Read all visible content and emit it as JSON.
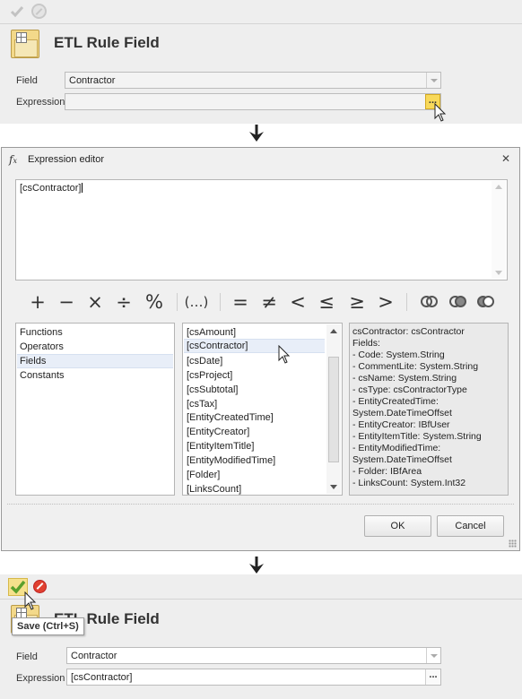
{
  "top_form": {
    "toolbar": {
      "save_icon": "check-icon",
      "cancel_icon": "cancel-icon"
    },
    "title": "ETL Rule Field",
    "field_label": "Field",
    "field_value": "Contractor",
    "expression_label": "Expression",
    "expression_value": "",
    "browse_label": "..."
  },
  "expression_editor": {
    "title": "Expression editor",
    "close_label": "✕",
    "expression_text": "[csContractor]",
    "operators": [
      "+",
      "−",
      "×",
      "÷",
      "%",
      "(…)",
      "=",
      "≠",
      "<",
      "≤",
      "≥",
      ">"
    ],
    "set_operators": [
      "union-icon",
      "intersection-icon",
      "difference-icon"
    ],
    "categories": [
      "Functions",
      "Operators",
      "Fields",
      "Constants"
    ],
    "selected_category": "Fields",
    "fields": [
      "[csAmount]",
      "[csContractor]",
      "[csDate]",
      "[csProject]",
      "[csSubtotal]",
      "[csTax]",
      "[EntityCreatedTime]",
      "[EntityCreator]",
      "[EntityItemTitle]",
      "[EntityModifiedTime]",
      "[Folder]",
      "[LinksCount]"
    ],
    "selected_field": "[csContractor]",
    "info_lines": [
      "csContractor: csContractor",
      "Fields:",
      " - Code: System.String",
      " - CommentLite: System.String",
      " - csName: System.String",
      " - csType: csContractorType",
      " - EntityCreatedTime:",
      "System.DateTimeOffset",
      " - EntityCreator: IBfUser",
      " - EntityItemTitle: System.String",
      " - EntityModifiedTime:",
      "System.DateTimeOffset",
      " - Folder: IBfArea",
      " - LinksCount: System.Int32"
    ],
    "ok_label": "OK",
    "cancel_label": "Cancel"
  },
  "bottom_form": {
    "toolbar": {
      "save_icon": "check-icon",
      "cancel_icon": "cancel-icon"
    },
    "tooltip": "Save (Ctrl+S)",
    "title": "ETL Rule Field",
    "field_label": "Field",
    "field_value": "Contractor",
    "expression_label": "Expression",
    "expression_value": "[csContractor]",
    "browse_label": "..."
  },
  "colors": {
    "panel_bg": "#eeeeee",
    "dialog_bg": "#f0f0f0",
    "highlight_button": "#f8d95a",
    "save_active_bg": "#f6e18c",
    "cancel_active": "#e04030",
    "check_green": "#5aa02c"
  }
}
